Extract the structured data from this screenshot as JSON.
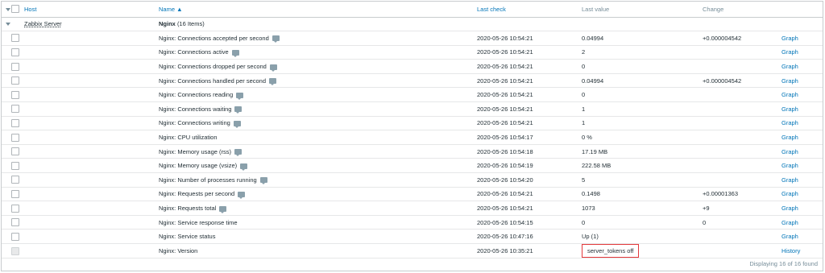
{
  "header": {
    "host": "Host",
    "name": "Name ▲",
    "last_check": "Last check",
    "last_value": "Last value",
    "change": "Change"
  },
  "group": {
    "host": "Zabbix Server",
    "name": "Nginx",
    "count": "(16 Items)"
  },
  "rows": [
    {
      "name": "Nginx: Connections accepted per second",
      "desc": true,
      "last_check": "2020-05-26 10:54:21",
      "last_value": "0.04994",
      "change": "+0.000004542",
      "action": "Graph"
    },
    {
      "name": "Nginx: Connections active",
      "desc": true,
      "last_check": "2020-05-26 10:54:21",
      "last_value": "2",
      "change": "",
      "action": "Graph"
    },
    {
      "name": "Nginx: Connections dropped per second",
      "desc": true,
      "last_check": "2020-05-26 10:54:21",
      "last_value": "0",
      "change": "",
      "action": "Graph"
    },
    {
      "name": "Nginx: Connections handled per second",
      "desc": true,
      "last_check": "2020-05-26 10:54:21",
      "last_value": "0.04994",
      "change": "+0.000004542",
      "action": "Graph"
    },
    {
      "name": "Nginx: Connections reading",
      "desc": true,
      "last_check": "2020-05-26 10:54:21",
      "last_value": "0",
      "change": "",
      "action": "Graph"
    },
    {
      "name": "Nginx: Connections waiting",
      "desc": true,
      "last_check": "2020-05-26 10:54:21",
      "last_value": "1",
      "change": "",
      "action": "Graph"
    },
    {
      "name": "Nginx: Connections writing",
      "desc": true,
      "last_check": "2020-05-26 10:54:21",
      "last_value": "1",
      "change": "",
      "action": "Graph"
    },
    {
      "name": "Nginx: CPU utilization",
      "desc": false,
      "last_check": "2020-05-26 10:54:17",
      "last_value": "0 %",
      "change": "",
      "action": "Graph"
    },
    {
      "name": "Nginx: Memory usage (rss)",
      "desc": true,
      "last_check": "2020-05-26 10:54:18",
      "last_value": "17.19 MB",
      "change": "",
      "action": "Graph"
    },
    {
      "name": "Nginx: Memory usage (vsize)",
      "desc": true,
      "last_check": "2020-05-26 10:54:19",
      "last_value": "222.58 MB",
      "change": "",
      "action": "Graph"
    },
    {
      "name": "Nginx: Number of processes running",
      "desc": true,
      "last_check": "2020-05-26 10:54:20",
      "last_value": "5",
      "change": "",
      "action": "Graph"
    },
    {
      "name": "Nginx: Requests per second",
      "desc": true,
      "last_check": "2020-05-26 10:54:21",
      "last_value": "0.1498",
      "change": "+0.00001363",
      "action": "Graph"
    },
    {
      "name": "Nginx: Requests total",
      "desc": true,
      "last_check": "2020-05-26 10:54:21",
      "last_value": "1073",
      "change": "+9",
      "action": "Graph"
    },
    {
      "name": "Nginx: Service response time",
      "desc": false,
      "last_check": "2020-05-26 10:54:15",
      "last_value": "0",
      "change": "0",
      "action": "Graph"
    },
    {
      "name": "Nginx: Service status",
      "desc": false,
      "last_check": "2020-05-26 10:47:16",
      "last_value": "Up (1)",
      "change": "",
      "action": "Graph"
    },
    {
      "name": "Nginx: Version",
      "desc": false,
      "last_check": "2020-05-26 10:35:21",
      "last_value": "server_tokens off",
      "change": "",
      "action": "History",
      "highlight": true,
      "disabled": true
    }
  ],
  "footer": "Displaying 16 of 16 found"
}
